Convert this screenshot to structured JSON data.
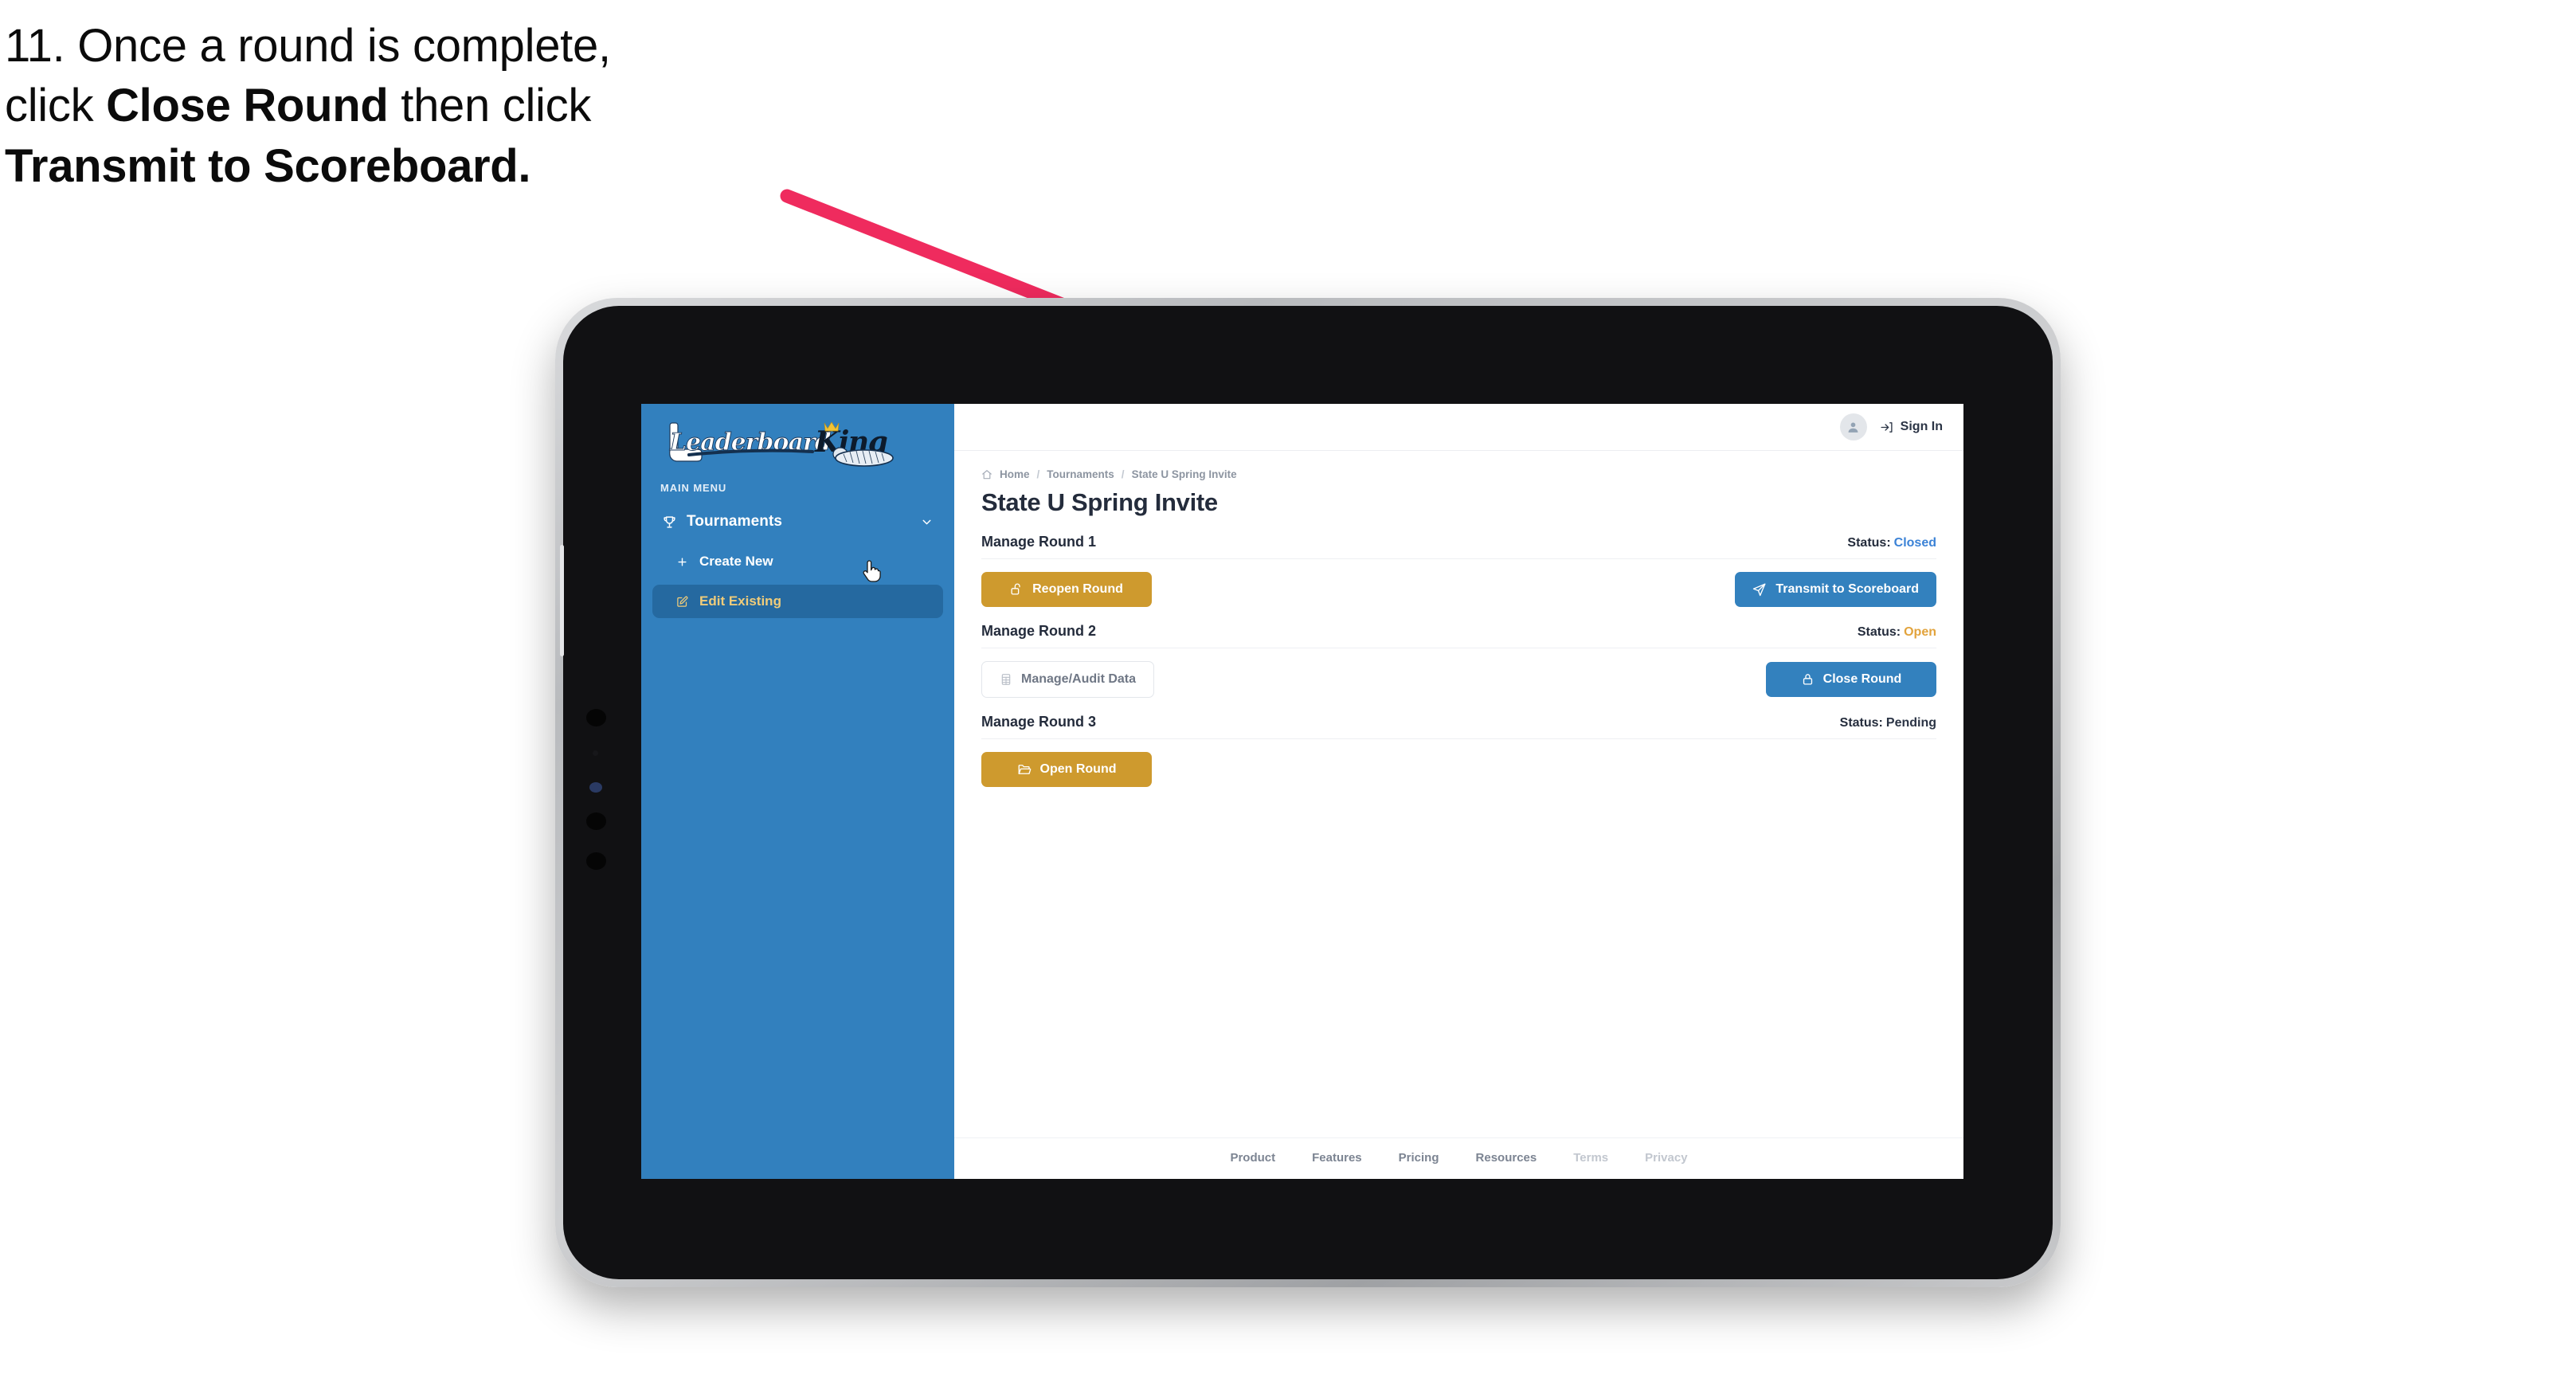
{
  "caption": {
    "step_number": "11.",
    "line1_pre": "11. Once a round is complete,",
    "line2_pre": "click ",
    "line2_bold": "Close Round",
    "line2_post": " then click",
    "line3_bold": "Transmit to Scoreboard."
  },
  "annotation": {
    "arrow_color": "#ef2b5e"
  },
  "app": {
    "sidebar": {
      "logo_text": "LeaderboardKing",
      "logo_word_1": "Leaderboard",
      "logo_word_2": "King",
      "section_label": "MAIN MENU",
      "nav": [
        {
          "label": "Tournaments",
          "icon": "trophy-icon",
          "chevron": "chevron-down-icon",
          "active": false
        }
      ],
      "sub_nav": [
        {
          "label": "Create New",
          "icon": "plus-icon",
          "active": false
        },
        {
          "label": "Edit Existing",
          "icon": "edit-icon",
          "active": true
        }
      ],
      "accent_color": "#3280be",
      "active_bg": "#2569a0",
      "active_text": "#f0cc7a",
      "cursor": "pointer-hand-cursor"
    },
    "topbar": {
      "avatar_icon": "user-avatar-icon",
      "signin_icon": "sign-in-arrow-icon",
      "signin_label": "Sign In"
    },
    "breadcrumb": {
      "home_icon": "home-icon",
      "items": [
        "Home",
        "Tournaments",
        "State U Spring Invite"
      ],
      "separator": "/"
    },
    "page_title": "State U Spring Invite",
    "rounds": [
      {
        "title": "Manage Round 1",
        "status_label": "Status:",
        "status_value": "Closed",
        "status_class": "st-closed",
        "left_button": {
          "label": "Reopen Round",
          "icon": "unlock-icon",
          "style": "gold"
        },
        "right_button": {
          "label": "Transmit to Scoreboard",
          "icon": "paper-plane-icon",
          "style": "blue"
        }
      },
      {
        "title": "Manage Round 2",
        "status_label": "Status:",
        "status_value": "Open",
        "status_class": "st-open",
        "left_button": {
          "label": "Manage/Audit Data",
          "icon": "table-grid-icon",
          "style": "ghost"
        },
        "right_button": {
          "label": "Close Round",
          "icon": "lock-icon",
          "style": "blue"
        }
      },
      {
        "title": "Manage Round 3",
        "status_label": "Status:",
        "status_value": "Pending",
        "status_class": "st-pending",
        "left_button": {
          "label": "Open Round",
          "icon": "folder-open-icon",
          "style": "gold"
        },
        "right_button": null
      }
    ],
    "footer": {
      "links": [
        {
          "label": "Product",
          "dim": false
        },
        {
          "label": "Features",
          "dim": false
        },
        {
          "label": "Pricing",
          "dim": false
        },
        {
          "label": "Resources",
          "dim": false
        },
        {
          "label": "Terms",
          "dim": true
        },
        {
          "label": "Privacy",
          "dim": true
        }
      ]
    },
    "colors": {
      "gold": "#ce9a2e",
      "blue": "#3381be",
      "sidebar": "#3280be",
      "status_closed": "#3b82d6",
      "status_open": "#e2a33c"
    }
  }
}
